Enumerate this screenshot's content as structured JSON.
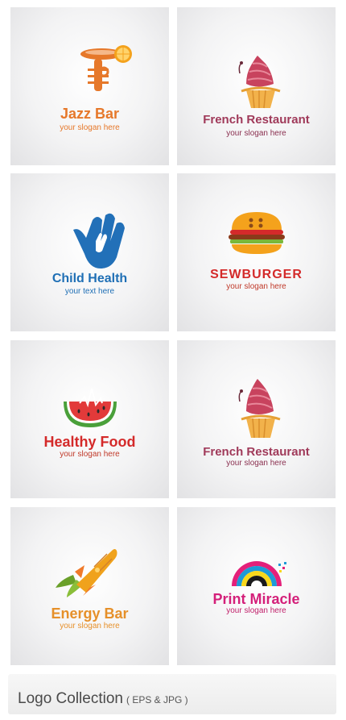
{
  "tiles": [
    {
      "name": "Jazz Bar",
      "slogan": "your slogan here",
      "name_color": "#e6782a",
      "slogan_color": "#e6782a"
    },
    {
      "name": "French Restaurant",
      "slogan": "your slogan here",
      "name_color": "#a03a5a",
      "slogan_color": "#8a3050"
    },
    {
      "name": "Child Health",
      "slogan": "your text here",
      "name_color": "#1f6fb5",
      "slogan_color": "#1f6fb5"
    },
    {
      "name": "SEWBURGER",
      "slogan": "your slogan here",
      "name_color": "#d42a2a",
      "slogan_color": "#c03a2a"
    },
    {
      "name": "Healthy Food",
      "slogan": "your slogan here",
      "name_color": "#d42a2a",
      "slogan_color": "#c03a2a"
    },
    {
      "name": "French Restaurant",
      "slogan": "your slogan here",
      "name_color": "#a03a5a",
      "slogan_color": "#8a3050"
    },
    {
      "name": "Energy Bar",
      "slogan": "your slogan here",
      "name_color": "#e6902a",
      "slogan_color": "#e6902a"
    },
    {
      "name": "Print Miracle",
      "slogan": "your slogan here",
      "name_color": "#d4207a",
      "slogan_color": "#c0206a"
    }
  ],
  "footer": {
    "title": "Logo Collection",
    "subtitle": "( EPS & JPG )"
  }
}
